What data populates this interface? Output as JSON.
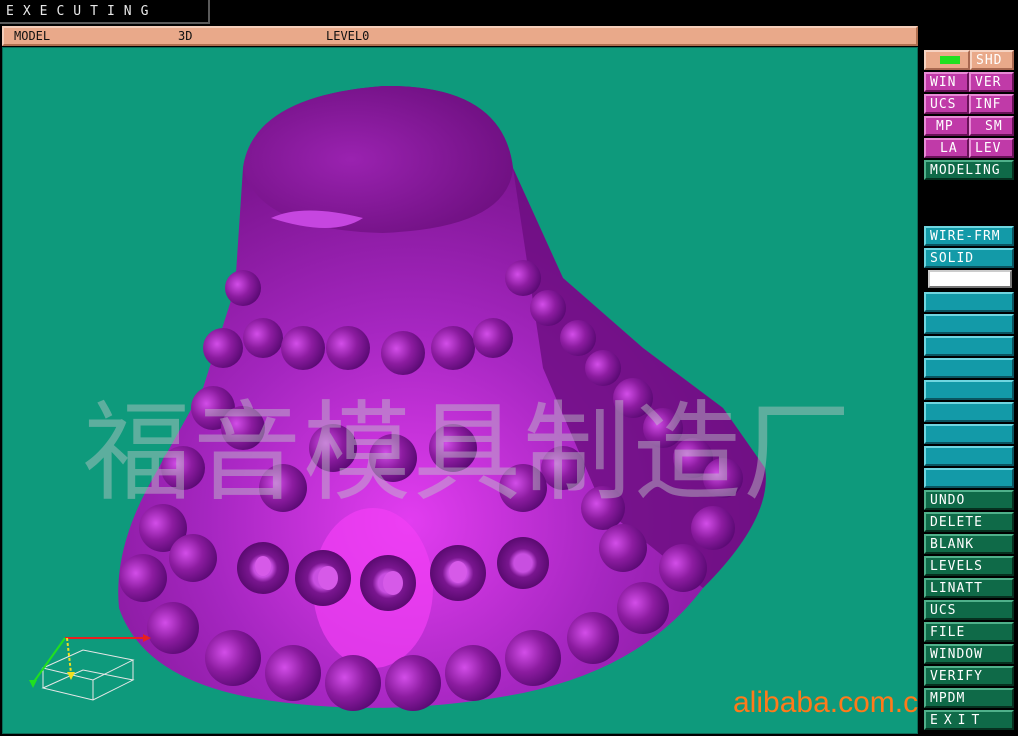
{
  "status": {
    "text": "EXECUTING"
  },
  "info_bar": {
    "mode": "MODEL",
    "view": "3D",
    "level": "LEVEL0"
  },
  "panel_top": {
    "shd": "SHD",
    "rows": [
      [
        "WIN",
        "VER"
      ],
      [
        "UCS",
        "INF"
      ],
      [
        "MP",
        "SM"
      ],
      [
        "LA",
        "LEV"
      ]
    ],
    "modeling": "MODELING"
  },
  "panel_mid": {
    "wire_frm": "WIRE-FRM",
    "solid": "SOLID"
  },
  "panel_bottom": {
    "items": [
      "UNDO",
      "DELETE",
      "BLANK",
      "LEVELS",
      "LINATT",
      "UCS",
      "FILE",
      "WINDOW",
      "VERIFY",
      "MPDM",
      "EXIT"
    ]
  },
  "watermark": "福音模具制造厂",
  "site_mark": "alibaba.com.cn",
  "colors": {
    "viewport_bg": "#0e9a7c",
    "model_purple": "#8a1a9a",
    "model_highlight": "#d63ae8",
    "accent_pink": "#c03aa8",
    "accent_cyan": "#139aa8",
    "accent_green": "#0f6a48"
  },
  "icons": {
    "triad": "axis-triad-icon",
    "indicator": "shaded-indicator-icon"
  }
}
